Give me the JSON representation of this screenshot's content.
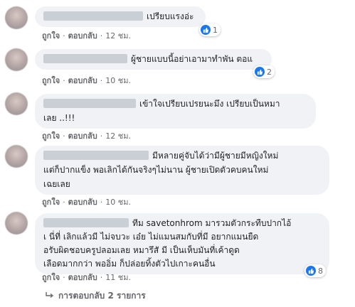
{
  "comments": [
    {
      "text": "เปรียบแรงอ่ะ",
      "like_label": "ถูกใจ",
      "reply_label": "ตอบกลับ",
      "time": "12 ชม.",
      "reactions": "1"
    },
    {
      "text": "ผู้ชายแบบนี้อย่าเอามาทำพัน  ตอแ",
      "like_label": "ถูกใจ",
      "reply_label": "ตอบกลับ",
      "time": "10 ชม.",
      "reactions": "2"
    },
    {
      "line1": "เข้าใจเปรียบเปรยนะมึง เปรียบเป็นหมา",
      "line2": "เลย ..!!!",
      "like_label": "ถูกใจ",
      "reply_label": "ตอบกลับ",
      "time": "12 ชม."
    },
    {
      "line1": "มีหลายคู่จับได้ว่ามีผู้ชายมีหญิงใหม่",
      "line2": "แต่ก็ปากแข็ง พอเลิกได้กันจริงๆไม่นาน ผู้ชายเปิดตัวคบคนใหม่",
      "line3": "เฉยเลย",
      "like_label": "ถูกใจ",
      "reply_label": "ตอบกลับ",
      "time": "10 ชม."
    },
    {
      "line1": "ทีม savetonhrom มารวมตัวกระทืบปากไอ้",
      "line2": "เ  นี่ที่ เลิกแล้วมี  ไม่จบวะ  เอ๋ย ไม่แมนสมกับที่มี  อยากแมนยืด",
      "line3": "อรับผิดชอบครูปลอมเลย หมารึสั  มี  เป็นเห็บมันที่เค้าดูด",
      "line4": "เลือดมากกว่า พออิ่ม ก็ปล่อยทิ้งตัวไปเกาะคนอื่น",
      "like_label": "ถูกใจ",
      "reply_label": "ตอบกลับ",
      "time": "11 ชม.",
      "reactions": "8"
    }
  ],
  "replies_link": "การตอบกลับ 2 รายการ",
  "colors": {
    "accent": "#1877f2",
    "bubble": "#f0f2f5",
    "meta": "#65676b"
  }
}
